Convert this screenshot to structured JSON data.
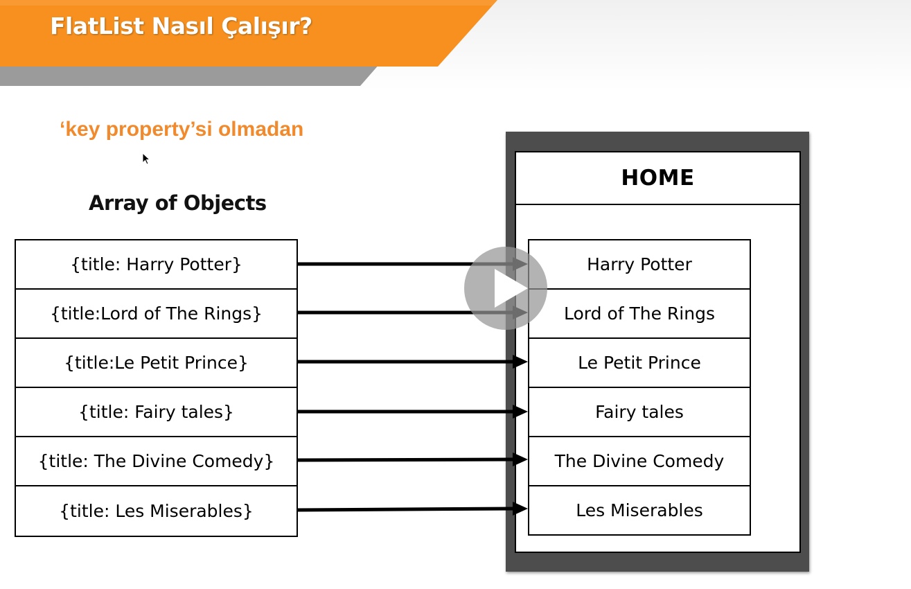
{
  "header": {
    "title": "FlatList Nasıl Çalışır?",
    "colors": {
      "banner": "#f7901e",
      "banner_shadow": "#9b9b9b",
      "title_text": "#ffffff"
    }
  },
  "subtitle": {
    "text": "‘key property’si olmadan",
    "color": "#f08a2c"
  },
  "array": {
    "heading": "Array of Objects",
    "items": [
      "{title: Harry Potter}",
      "{title:Lord of The Rings}",
      "{title:Le Petit Prince}",
      "{title: Fairy tales}",
      "{title: The Divine Comedy}",
      "{title: Les Miserables}"
    ]
  },
  "device": {
    "header": "HOME",
    "frame_color": "#4d4d4d",
    "items": [
      "Harry Potter",
      "Lord of The Rings",
      "Le Petit Prince",
      "Fairy tales",
      "The Divine Comedy",
      "Les Miserables"
    ]
  },
  "video": {
    "icon": "play-icon"
  }
}
